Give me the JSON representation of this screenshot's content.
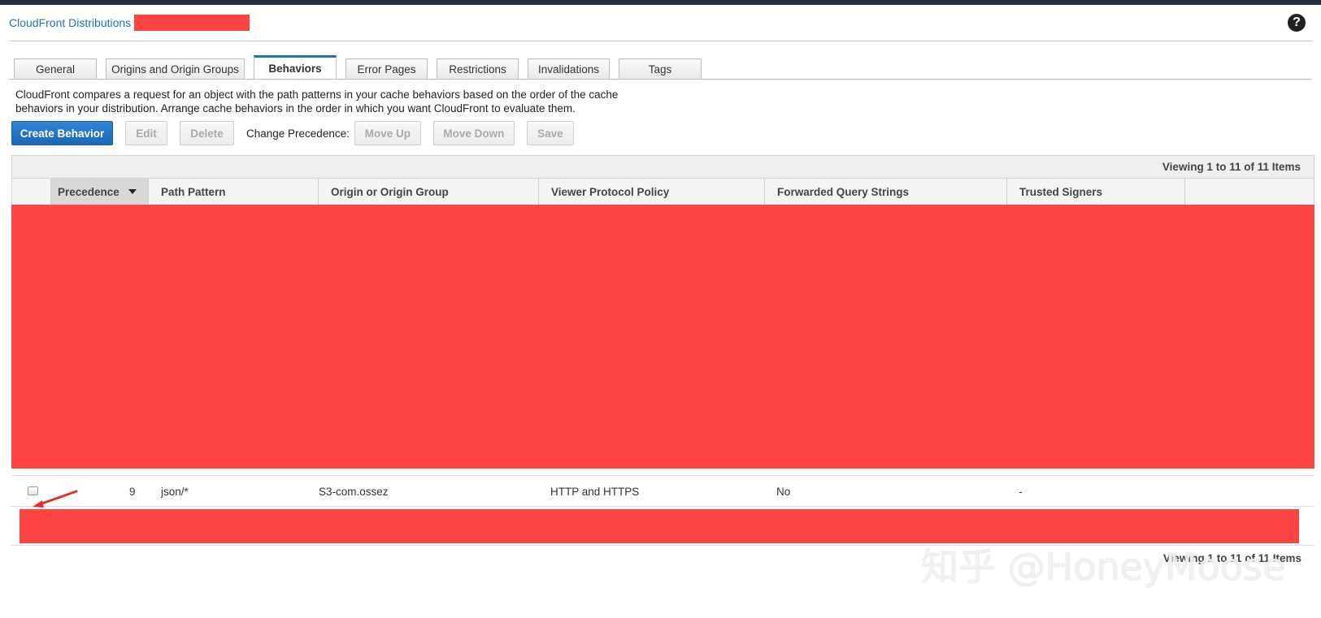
{
  "breadcrumb": {
    "root": "CloudFront Distributions"
  },
  "help": {
    "symbol": "?"
  },
  "tabs": [
    {
      "label": "General"
    },
    {
      "label": "Origins and Origin Groups"
    },
    {
      "label": "Behaviors"
    },
    {
      "label": "Error Pages"
    },
    {
      "label": "Restrictions"
    },
    {
      "label": "Invalidations"
    },
    {
      "label": "Tags"
    }
  ],
  "active_tab": "Behaviors",
  "description": "CloudFront compares a request for an object with the path patterns in your cache behaviors based on the order of the cache behaviors in your distribution. Arrange cache behaviors in the order in which you want CloudFront to evaluate them.",
  "toolbar": {
    "create": "Create Behavior",
    "edit": "Edit",
    "delete": "Delete",
    "change_precedence": "Change Precedence:",
    "move_up": "Move Up",
    "move_down": "Move Down",
    "save": "Save"
  },
  "table": {
    "viewing": "Viewing 1 to 11 of 11 Items",
    "columns": [
      "Precedence",
      "Path Pattern",
      "Origin or Origin Group",
      "Viewer Protocol Policy",
      "Forwarded Query Strings",
      "Trusted Signers"
    ],
    "visible_row": {
      "precedence": "9",
      "path_pattern": "json/*",
      "origin": "S3-com.ossez",
      "viewer_protocol_policy": "HTTP and HTTPS",
      "forwarded_query_strings": "No",
      "trusted_signers": "-"
    }
  },
  "watermark": "知乎 @HoneyMoose",
  "colors": {
    "accent": "#2074b5",
    "redaction": "#ff4444",
    "topbar": "#232f3e",
    "primary_button": "#1a66b4",
    "annotation_arrow": "#e03030"
  }
}
